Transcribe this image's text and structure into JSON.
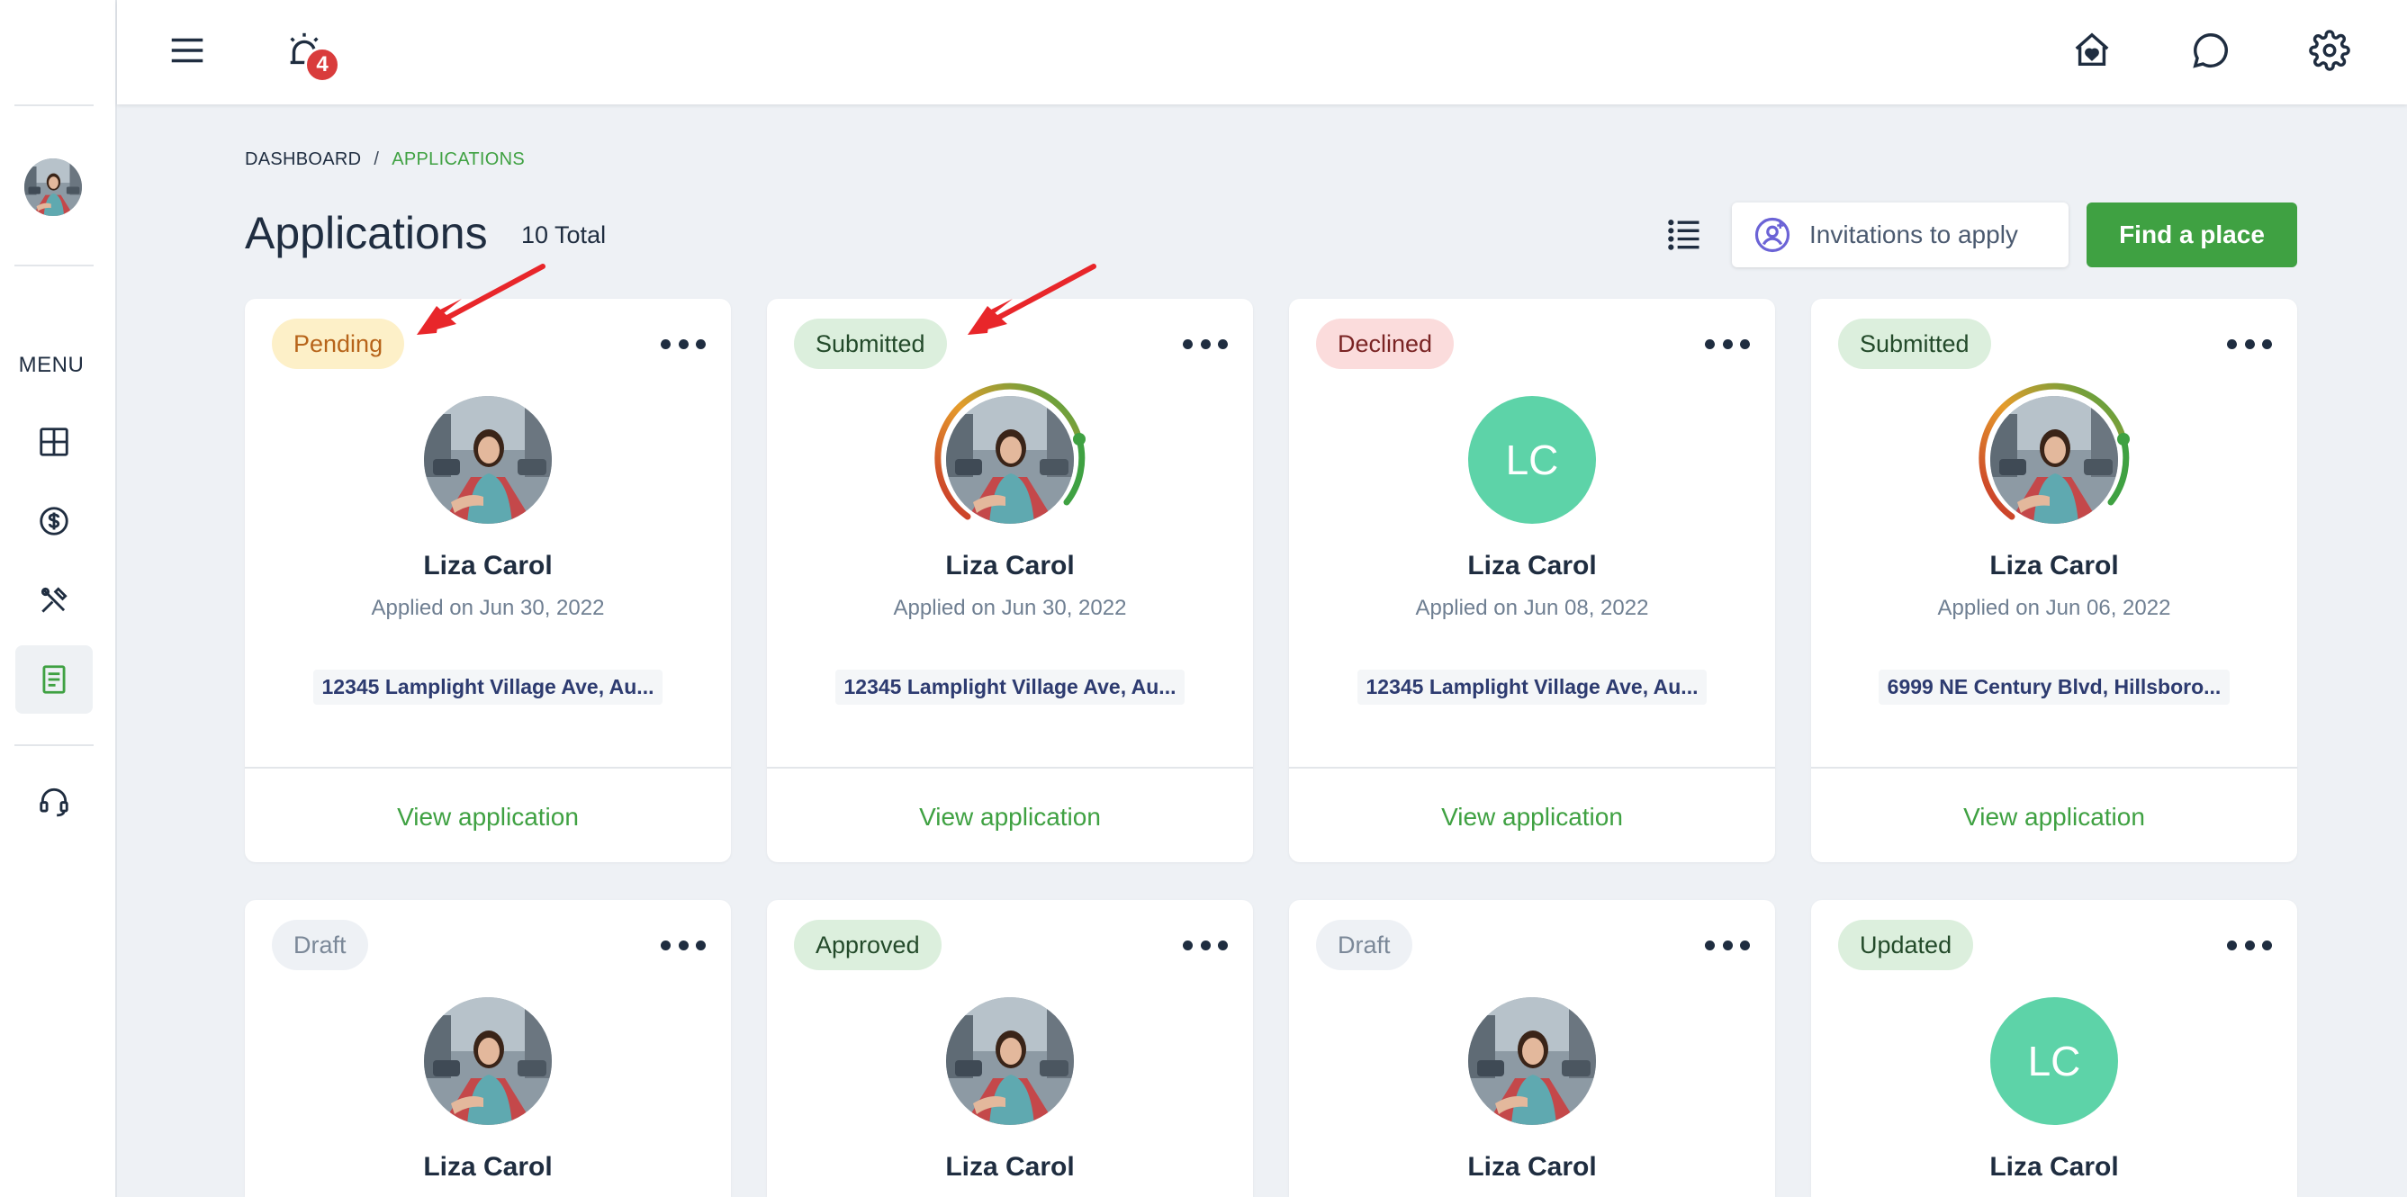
{
  "sidebar": {
    "menu_label": "MENU",
    "items": [
      {
        "name": "dashboard",
        "icon": "grid-icon"
      },
      {
        "name": "payments",
        "icon": "dollar-icon"
      },
      {
        "name": "maintenance",
        "icon": "tools-icon"
      },
      {
        "name": "applications",
        "icon": "document-icon",
        "active": true
      },
      {
        "name": "support",
        "icon": "headset-icon"
      }
    ]
  },
  "topbar": {
    "notification_count": "4",
    "icons": [
      "menu-icon",
      "alarm-icon",
      "home-heart-icon",
      "chat-icon",
      "gear-icon"
    ]
  },
  "breadcrumb": {
    "root": "DASHBOARD",
    "separator": "/",
    "current": "APPLICATIONS"
  },
  "header": {
    "title": "Applications",
    "total": "10 Total",
    "invite_label": "Invitations to apply",
    "find_label": "Find a place"
  },
  "colors": {
    "accent": "#3fa142",
    "initials_bg": "#5dd3a8",
    "arrow": "#e8262a"
  },
  "cards": [
    {
      "status": "Pending",
      "status_class": "pending",
      "name": "Liza Carol",
      "applied": "Applied on Jun 30, 2022",
      "address": "12345 Lamplight Village Ave, Au...",
      "action": "View application",
      "avatar": "photo",
      "ring": false
    },
    {
      "status": "Submitted",
      "status_class": "submitted",
      "name": "Liza Carol",
      "applied": "Applied on Jun 30, 2022",
      "address": "12345 Lamplight Village Ave, Au...",
      "action": "View application",
      "avatar": "photo",
      "ring": true
    },
    {
      "status": "Declined",
      "status_class": "declined",
      "name": "Liza Carol",
      "applied": "Applied on Jun 08, 2022",
      "address": "12345 Lamplight Village Ave, Au...",
      "action": "View application",
      "avatar": "initials",
      "initials": "LC",
      "ring": false
    },
    {
      "status": "Submitted",
      "status_class": "submitted",
      "name": "Liza Carol",
      "applied": "Applied on Jun 06, 2022",
      "address": "6999 NE Century Blvd, Hillsboro...",
      "action": "View application",
      "avatar": "photo",
      "ring": true
    },
    {
      "status": "Draft",
      "status_class": "draft",
      "name": "Liza Carol",
      "avatar": "photo",
      "ring": false
    },
    {
      "status": "Approved",
      "status_class": "approved",
      "name": "Liza Carol",
      "avatar": "photo",
      "ring": false
    },
    {
      "status": "Draft",
      "status_class": "draft",
      "name": "Liza Carol",
      "avatar": "photo",
      "ring": false
    },
    {
      "status": "Updated",
      "status_class": "updated",
      "name": "Liza Carol",
      "avatar": "initials",
      "initials": "LC",
      "ring": false
    }
  ]
}
